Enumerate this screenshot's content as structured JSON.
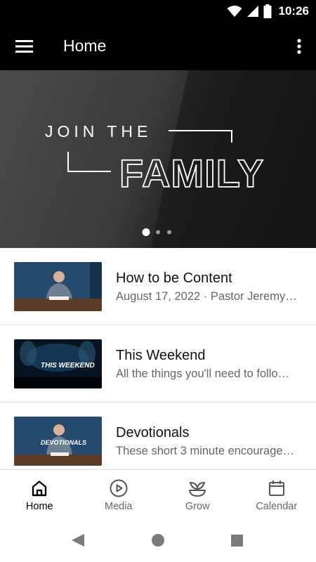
{
  "status_bar": {
    "time": "10:26",
    "icons": [
      "wifi-icon",
      "cell-signal-icon",
      "battery-icon"
    ]
  },
  "app_bar": {
    "title": "Home",
    "menu_icon": "hamburger-menu-icon",
    "overflow_icon": "more-vertical-icon"
  },
  "hero": {
    "line1": "JOIN THE",
    "line2": "FAMILY",
    "carousel_pages": 3,
    "active_page": 1
  },
  "feed": {
    "items": [
      {
        "title": "How to be Content",
        "subtitle": "August 17, 2022 · Pastor Jeremy…",
        "thumb": "pastor-at-desk"
      },
      {
        "title": "This Weekend",
        "subtitle": "All the things you'll need to follo…",
        "thumb": "worship-stage",
        "thumb_caption": "THIS WEEKEND"
      },
      {
        "title": "Devotionals",
        "subtitle": "These short 3 minute encourage…",
        "thumb": "pastor-at-desk",
        "thumb_caption": "DEVOTIONALS"
      }
    ]
  },
  "bottom_nav": {
    "items": [
      {
        "label": "Home",
        "icon": "home-icon",
        "active": true
      },
      {
        "label": "Media",
        "icon": "play-circle-icon",
        "active": false
      },
      {
        "label": "Grow",
        "icon": "sprout-icon",
        "active": false
      },
      {
        "label": "Calendar",
        "icon": "calendar-icon",
        "active": false
      }
    ]
  },
  "system_nav": [
    "back-icon",
    "home-circle-icon",
    "recents-icon"
  ],
  "colors": {
    "bar_bg": "#000000",
    "text_secondary": "#666666",
    "divider": "#e3e3e3"
  }
}
